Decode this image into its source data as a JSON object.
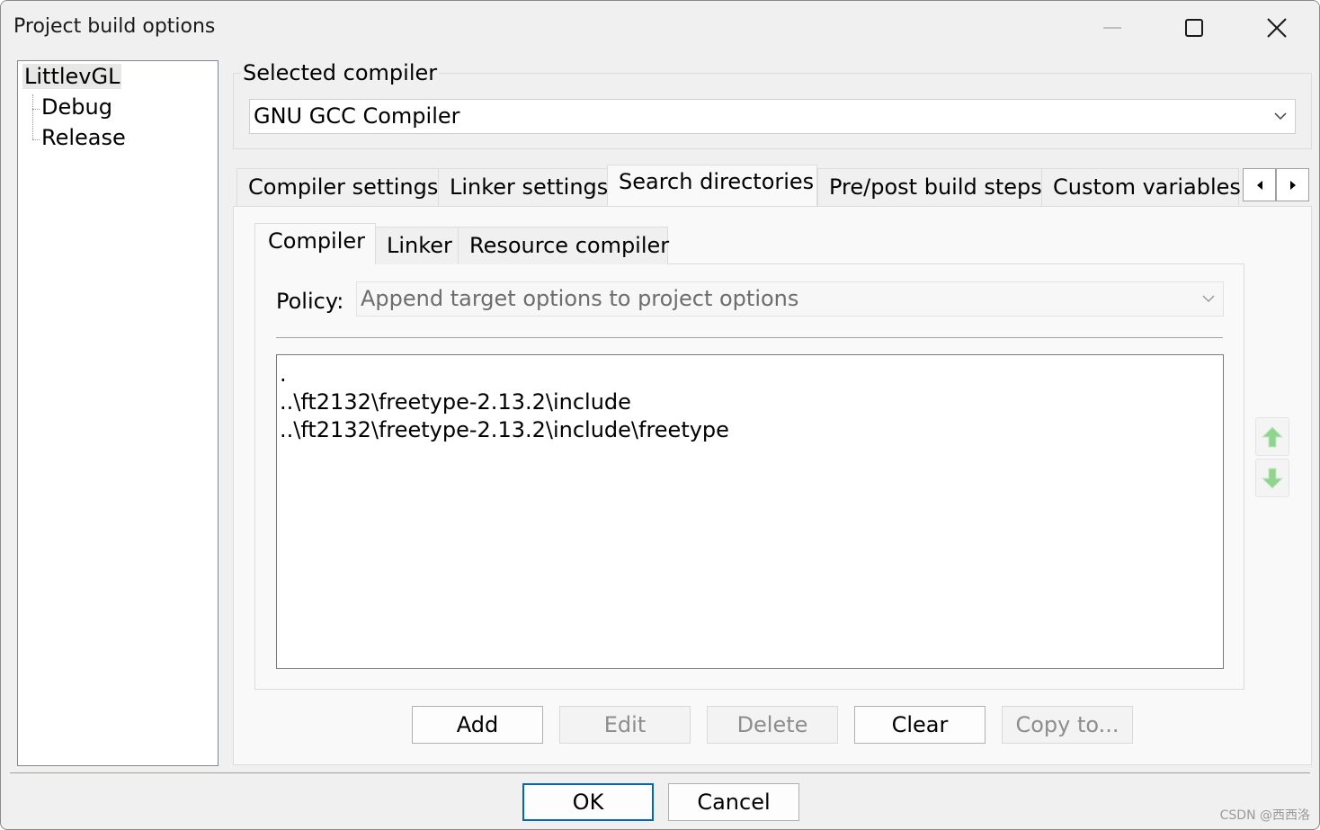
{
  "window": {
    "title": "Project build options"
  },
  "tree": {
    "root": "LittlevGL",
    "children": [
      "Debug",
      "Release"
    ]
  },
  "selected_compiler": {
    "label": "Selected compiler",
    "value": "GNU GCC Compiler"
  },
  "outer_tabs": [
    "Compiler settings",
    "Linker settings",
    "Search directories",
    "Pre/post build steps",
    "Custom variables"
  ],
  "outer_tabs_active": "Search directories",
  "inner_tabs": [
    "Compiler",
    "Linker",
    "Resource compiler"
  ],
  "inner_tabs_active": "Compiler",
  "policy": {
    "label": "Policy:",
    "value": "Append target options to project options"
  },
  "directories": [
    ".",
    "..\\ft2132\\freetype-2.13.2\\include",
    "..\\ft2132\\freetype-2.13.2\\include\\freetype"
  ],
  "buttons": {
    "add": "Add",
    "edit": "Edit",
    "delete": "Delete",
    "clear": "Clear",
    "copy_to": "Copy to..."
  },
  "dialog_buttons": {
    "ok": "OK",
    "cancel": "Cancel"
  },
  "watermark": "CSDN @西西洛",
  "colors": {
    "arrow_green": "#7ccf7c",
    "default_button_border": "#0067c0"
  }
}
